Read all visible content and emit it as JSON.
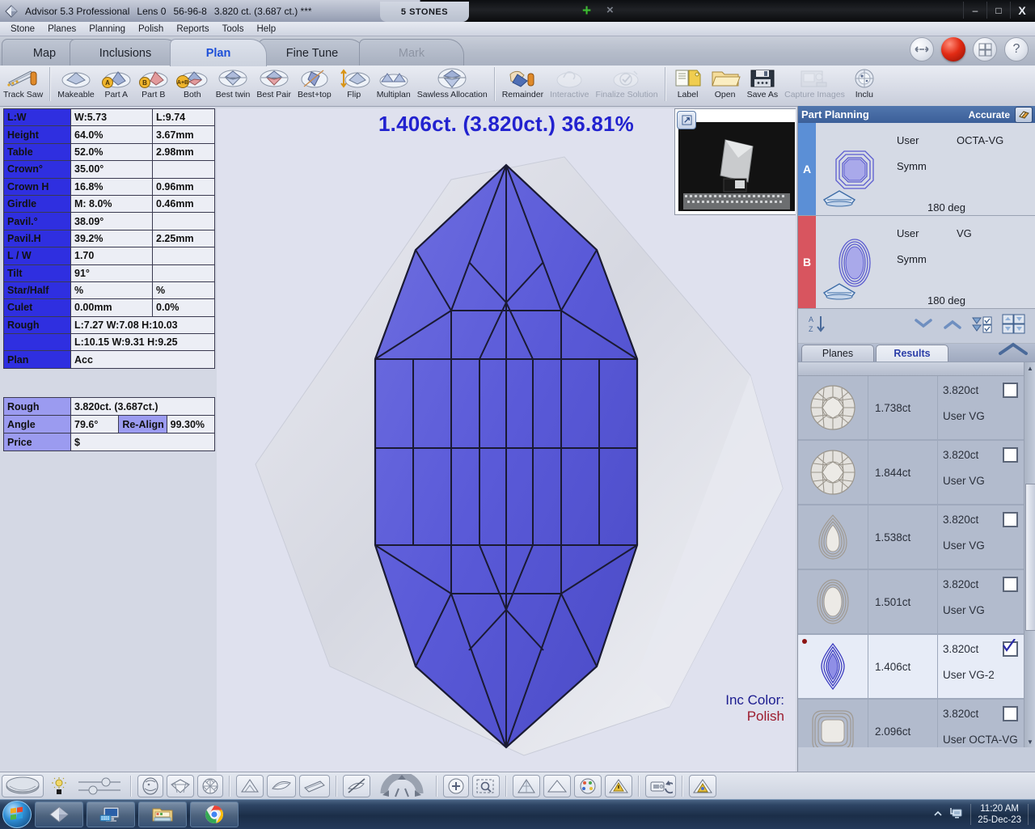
{
  "titlebar": {
    "app_title": "Advisor 5.3 Professional",
    "lens": "Lens 0",
    "stone_id": "56-96-8",
    "weight": "3.820 ct. (3.687 ct.) ***",
    "doc_tab": "5 STONES",
    "add_tab": "+",
    "close_tab": "×",
    "minimize": "–",
    "maximize": "□",
    "close": "X"
  },
  "menu": [
    "Stone",
    "Planes",
    "Planning",
    "Polish",
    "Reports",
    "Tools",
    "Help"
  ],
  "tabs": [
    {
      "label": "Map",
      "active": false,
      "disabled": false
    },
    {
      "label": "Inclusions",
      "active": false,
      "disabled": false
    },
    {
      "label": "Plan",
      "active": true,
      "disabled": false
    },
    {
      "label": "Fine Tune",
      "active": false,
      "disabled": false
    },
    {
      "label": "Mark",
      "active": false,
      "disabled": true
    }
  ],
  "tab_icons": [
    {
      "name": "left-right-arrow-icon"
    },
    {
      "name": "red-sphere-icon"
    },
    {
      "name": "grid-view-icon"
    },
    {
      "name": "help-icon",
      "label": "?"
    }
  ],
  "toolbar": [
    {
      "label": "Track Saw",
      "icon": "track-saw-icon",
      "dim": false
    },
    {
      "sep": true
    },
    {
      "label": "Makeable",
      "icon": "makeable-icon",
      "dim": false
    },
    {
      "label": "Part A",
      "icon": "part-a-icon",
      "dim": false
    },
    {
      "label": "Part B",
      "icon": "part-b-icon",
      "dim": false
    },
    {
      "label": "Both",
      "icon": "both-icon",
      "dim": false
    },
    {
      "label": "Best twin",
      "icon": "best-twin-icon",
      "dim": false
    },
    {
      "label": "Best Pair",
      "icon": "best-pair-icon",
      "dim": false
    },
    {
      "label": "Best+top",
      "icon": "best-top-icon",
      "dim": false
    },
    {
      "label": "Flip",
      "icon": "flip-icon",
      "dim": false
    },
    {
      "label": "Multiplan",
      "icon": "multiplan-icon",
      "dim": false
    },
    {
      "label": "Sawless Allocation",
      "icon": "sawless-allocation-icon",
      "dim": false
    },
    {
      "sep": true
    },
    {
      "label": "Remainder",
      "icon": "remainder-icon",
      "dim": false
    },
    {
      "label": "Interactive",
      "icon": "interactive-icon",
      "dim": true
    },
    {
      "label": "Finalize Solution",
      "icon": "finalize-solution-icon",
      "dim": true
    },
    {
      "sep": true
    },
    {
      "label": "Label",
      "icon": "label-icon",
      "dim": false
    },
    {
      "label": "Open",
      "icon": "open-folder-icon",
      "dim": false
    },
    {
      "label": "Save As",
      "icon": "save-as-icon",
      "dim": false
    },
    {
      "label": "Capture Images",
      "icon": "capture-images-icon",
      "dim": true
    },
    {
      "label": "Inclu",
      "icon": "inclusions-icon",
      "dim": false
    }
  ],
  "params_table": [
    {
      "label": "L:W",
      "v1": "W:5.73",
      "v2": "L:9.74"
    },
    {
      "label": "Height",
      "v1": "64.0%",
      "v2": "3.67mm"
    },
    {
      "label": "Table",
      "v1": "52.0%",
      "v2": "2.98mm"
    },
    {
      "label": "Crown°",
      "v1": "35.00°",
      "v2": ""
    },
    {
      "label": "Crown H",
      "v1": "16.8%",
      "v2": "0.96mm"
    },
    {
      "label": "Girdle",
      "v1": "M: 8.0%",
      "v2": "0.46mm"
    },
    {
      "label": "Pavil.°",
      "v1": "38.09°",
      "v2": ""
    },
    {
      "label": "Pavil.H",
      "v1": "39.2%",
      "v2": "2.25mm"
    },
    {
      "label": "L / W",
      "v1": "1.70",
      "v2": ""
    },
    {
      "label": "Tilt",
      "v1": "91°",
      "v2": ""
    },
    {
      "label": "Star/Half",
      "v1": "%",
      "v2": "%"
    },
    {
      "label": "Culet",
      "v1": "0.00mm",
      "v2": "0.0%"
    },
    {
      "label": "Rough",
      "span": "L:7.27 W:7.08 H:10.03"
    },
    {
      "label": "",
      "span": "L:10.15 W:9.31 H:9.25"
    },
    {
      "label": "Plan",
      "span": "Acc"
    }
  ],
  "rough_table": {
    "rough_label": "Rough",
    "rough_value": "3.820ct. (3.687ct.)",
    "angle_label": "Angle",
    "angle_value": "79.6°",
    "realign_label": "Re-Align",
    "realign_value": "99.30%",
    "price_label": "Price",
    "price_value": "$"
  },
  "viewport": {
    "headline": "1.406ct. (3.820ct.) 36.81%",
    "inc_color_label": "Inc Color:",
    "inc_color_value": "Polish",
    "expand_icon": "expand-icon",
    "inset_expand_icon": "expand-photo-icon"
  },
  "part_planning": {
    "title": "Part Planning",
    "accuracy": "Accurate",
    "head_icon": "eraser-icon",
    "rows": [
      {
        "letter": "A",
        "user_label": "User",
        "user_value": "OCTA-VG",
        "symm_label": "Symm",
        "symm_value": "",
        "deg": "180 deg",
        "stone_icon": "octagon-stone-icon",
        "shape_icon": "pavilion-shape-icon"
      },
      {
        "letter": "B",
        "user_label": "User",
        "user_value": "VG",
        "symm_label": "Symm",
        "symm_value": "",
        "deg": "180 deg",
        "stone_icon": "oval-stone-icon",
        "shape_icon": "pavilion-shape-icon"
      }
    ],
    "sort_icons": [
      "sort-az-icon",
      "collapse-down-icon",
      "collapse-up-icon",
      "check-filter-icon",
      "grid-filter-icon"
    ]
  },
  "result_tabs": [
    {
      "label": "Planes",
      "active": false
    },
    {
      "label": "Results",
      "active": true
    }
  ],
  "results": [
    {
      "carat": "1.738ct",
      "rough": "3.820ct",
      "cut": "User VG",
      "checked": false,
      "selected": false,
      "shape": "round-brilliant-icon"
    },
    {
      "carat": "1.844ct",
      "rough": "3.820ct",
      "cut": "User VG",
      "checked": false,
      "selected": false,
      "shape": "round-brilliant-icon"
    },
    {
      "carat": "1.538ct",
      "rough": "3.820ct",
      "cut": "User VG",
      "checked": false,
      "selected": false,
      "shape": "pear-icon"
    },
    {
      "carat": "1.501ct",
      "rough": "3.820ct",
      "cut": "User VG",
      "checked": false,
      "selected": false,
      "shape": "oval-icon"
    },
    {
      "carat": "1.406ct",
      "rough": "3.820ct",
      "cut": "User VG-2",
      "checked": true,
      "selected": true,
      "shape": "marquise-icon"
    },
    {
      "carat": "2.096ct",
      "rough": "3.820ct",
      "cut": "User OCTA-VG",
      "checked": false,
      "selected": false,
      "shape": "cushion-icon"
    }
  ],
  "bottom_toolbar": [
    {
      "icon": "mouse-pointer-3d-icon"
    },
    {
      "icon": "brightness-icon"
    },
    {
      "icon": "slider-icon"
    },
    {
      "sep": true
    },
    {
      "icon": "inclusion-view-icon"
    },
    {
      "icon": "diamond-view-icon"
    },
    {
      "icon": "facet-view-icon"
    },
    {
      "sep": true
    },
    {
      "icon": "crown-view-icon"
    },
    {
      "icon": "pavilion-view-icon"
    },
    {
      "icon": "side-view-icon"
    },
    {
      "sep": true
    },
    {
      "icon": "cutaway-icon"
    },
    {
      "icon": "rotate-pad-icon"
    },
    {
      "sep": true
    },
    {
      "icon": "zoom-in-icon"
    },
    {
      "icon": "zoom-region-icon"
    },
    {
      "sep": true
    },
    {
      "icon": "perspective-icon"
    },
    {
      "icon": "flat-view-icon"
    },
    {
      "icon": "color-palette-icon"
    },
    {
      "icon": "warning-triangle-icon"
    },
    {
      "sep": true
    },
    {
      "icon": "rotate-camera-icon"
    },
    {
      "sep": true
    },
    {
      "icon": "highlight-icon"
    }
  ],
  "taskbar": {
    "start": "start-orb-icon",
    "buttons": [
      {
        "icon": "diamond-app-icon"
      },
      {
        "icon": "computer-icon"
      },
      {
        "icon": "explorer-folder-icon"
      },
      {
        "icon": "chrome-icon"
      }
    ],
    "tray_arrow": "show-hidden-icons-icon",
    "tray_icon": "network-icon",
    "time": "11:20 AM",
    "date": "25-Dec-23"
  },
  "colors": {
    "header_blue": "#2f2fe0",
    "accent_blue": "#2222cf",
    "part_a": "#5b8fd6",
    "part_b": "#d8555f",
    "red_text": "#b22222",
    "polish_red": "#9c1c2e",
    "stone_blue": "#5a5ad8"
  }
}
